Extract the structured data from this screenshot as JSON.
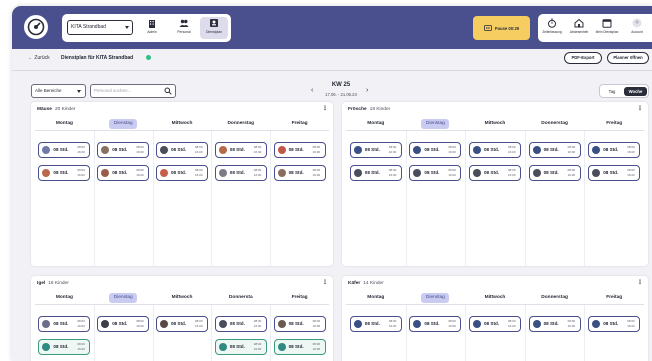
{
  "app": {
    "kita_select": "KITA Strandbad",
    "nav": [
      {
        "label": "Admin"
      },
      {
        "label": "Personal"
      },
      {
        "label": "Dienstplan"
      }
    ],
    "pause_label": "Pause 00:29",
    "right_nav": [
      {
        "label": "Zeiterfassung"
      },
      {
        "label": "Abwesenheit"
      },
      {
        "label": "Mein Dienstplan"
      },
      {
        "label": "Account"
      }
    ]
  },
  "subheader": {
    "back_label": "← Zurück",
    "title": "Dienstplan für KITA Strandbad",
    "pdf_label": "PDF-Export",
    "planner_label": "Planner öffnen"
  },
  "filters": {
    "area_select": "Alle Bereiche",
    "search_placeholder": "Personal suchen...",
    "week_title": "KW 25",
    "week_range": "17.06. - 21.06.24",
    "view_day": "Tag",
    "view_week": "Woche",
    "prev": "‹",
    "next": "›"
  },
  "groups": [
    {
      "name": "Mäuse",
      "count": "20 Kinder",
      "days": [
        "Montag",
        "Dienstag",
        "Mittwoch",
        "Donnerstag",
        "Freitag"
      ],
      "rows": [
        [
          {
            "hours": "08 Std.",
            "from": "08:00",
            "to": "16:00",
            "av": "#6f7aa8"
          },
          {
            "hours": "08 Std.",
            "from": "08:00",
            "to": "16:00",
            "av": "#8a7060"
          },
          {
            "hours": "08 Std.",
            "from": "08:00",
            "to": "16:00",
            "av": "#4a4d5a"
          },
          {
            "hours": "08 Std.",
            "from": "08:00",
            "to": "16:00",
            "av": "#b66a4a"
          },
          {
            "hours": "08 Std.",
            "from": "08:00",
            "to": "16:00",
            "av": "#c0584a"
          }
        ],
        [
          {
            "hours": "08 Std.",
            "from": "08:00",
            "to": "16:00",
            "av": "#b8664c"
          },
          {
            "hours": "08 Std.",
            "from": "08:00",
            "to": "16:00",
            "av": "#9a5c48"
          },
          {
            "hours": "08 Std.",
            "from": "08:00",
            "to": "16:00",
            "av": "#c7604a"
          },
          {
            "hours": "08 Std.",
            "from": "08:00",
            "to": "16:00",
            "av": "#7e7a86"
          },
          {
            "hours": "08 Std.",
            "from": "08:00",
            "to": "16:00",
            "av": "#8a6e5c"
          }
        ]
      ]
    },
    {
      "name": "Frösche",
      "count": "18 Kinder",
      "days": [
        "Montag",
        "Dienstag",
        "Mittwoch",
        "Donnerstag",
        "Freitag"
      ],
      "rows": [
        [
          {
            "hours": "08 Std.",
            "from": "08:00",
            "to": "16:00",
            "av": "#3a4f82"
          },
          {
            "hours": "08 Std.",
            "from": "08:00",
            "to": "16:00",
            "av": "#3a4f82"
          },
          {
            "hours": "08 Std.",
            "from": "08:00",
            "to": "16:00",
            "av": "#3a4f82"
          },
          {
            "hours": "08 Std.",
            "from": "08:00",
            "to": "16:00",
            "av": "#3a4f82"
          },
          {
            "hours": "08 Std.",
            "from": "08:00",
            "to": "16:00",
            "av": "#3a4f82"
          }
        ],
        [
          {
            "hours": "08 Std.",
            "from": "08:00",
            "to": "16:00",
            "av": "#4a4d5a"
          },
          {
            "hours": "08 Std.",
            "from": "08:00",
            "to": "16:00",
            "av": "#4a4d5a"
          },
          {
            "hours": "08 Std.",
            "from": "08:00",
            "to": "16:00",
            "av": "#4a4d5a"
          },
          {
            "hours": "08 Std.",
            "from": "08:00",
            "to": "16:00",
            "av": "#4a4d5a"
          },
          {
            "hours": "08 Std.",
            "from": "08:00",
            "to": "16:00",
            "av": "#4a4d5a"
          }
        ]
      ]
    },
    {
      "name": "Igel",
      "count": "16 Kinder",
      "days": [
        "Montag",
        "Dienstag",
        "Mittwoch",
        "Donnersta",
        "Freitag"
      ],
      "rows": [
        [
          {
            "hours": "08 Std.",
            "from": "08:00",
            "to": "16:00",
            "av": "#6a6e8a"
          },
          {
            "hours": "08 Std.",
            "from": "08:00",
            "to": "16:00",
            "av": "#3c3f4a"
          },
          {
            "hours": "08 Std.",
            "from": "08:00",
            "to": "16:00",
            "av": "#5a4a44"
          },
          {
            "hours": "08 Std.",
            "from": "08:00",
            "to": "16:00",
            "av": "#4a4d5a"
          },
          {
            "hours": "08 Std.",
            "from": "08:00",
            "to": "16:00",
            "av": "#6a5a50"
          }
        ],
        [
          {
            "hours": "08 Std.",
            "from": "08:00",
            "to": "16:00",
            "av": "#2f8a82",
            "green": true
          },
          null,
          null,
          {
            "hours": "08 Std.",
            "from": "08:00",
            "to": "16:00",
            "av": "#2f8a82",
            "green": true
          },
          {
            "hours": "08 Std.",
            "from": "08:00",
            "to": "16:00",
            "av": "#2f8a82",
            "green": true
          }
        ]
      ]
    },
    {
      "name": "Käfer",
      "count": "14 Kinder",
      "days": [
        "Montag",
        "Dienstag",
        "Mittwoch",
        "Donnerstag",
        "Freitag"
      ],
      "rows": [
        [
          {
            "hours": "08 Std.",
            "from": "08:00",
            "to": "16:00",
            "av": "#3a4f82"
          },
          {
            "hours": "08 Std.",
            "from": "08:00",
            "to": "16:00",
            "av": "#3a4f82"
          },
          {
            "hours": "08 Std.",
            "from": "08:00",
            "to": "16:00",
            "av": "#3a4f82"
          },
          {
            "hours": "08 Std.",
            "from": "08:00",
            "to": "16:00",
            "av": "#3a4f82"
          },
          {
            "hours": "08 Std.",
            "from": "08:00",
            "to": "16:00",
            "av": "#3a4f82"
          }
        ]
      ]
    }
  ],
  "colors": {
    "primary": "#4a4f8e",
    "pause": "#f5cd60",
    "today": "#c9cbf0",
    "status": "#2fbf86",
    "green_shift": "#3a9c7d"
  }
}
